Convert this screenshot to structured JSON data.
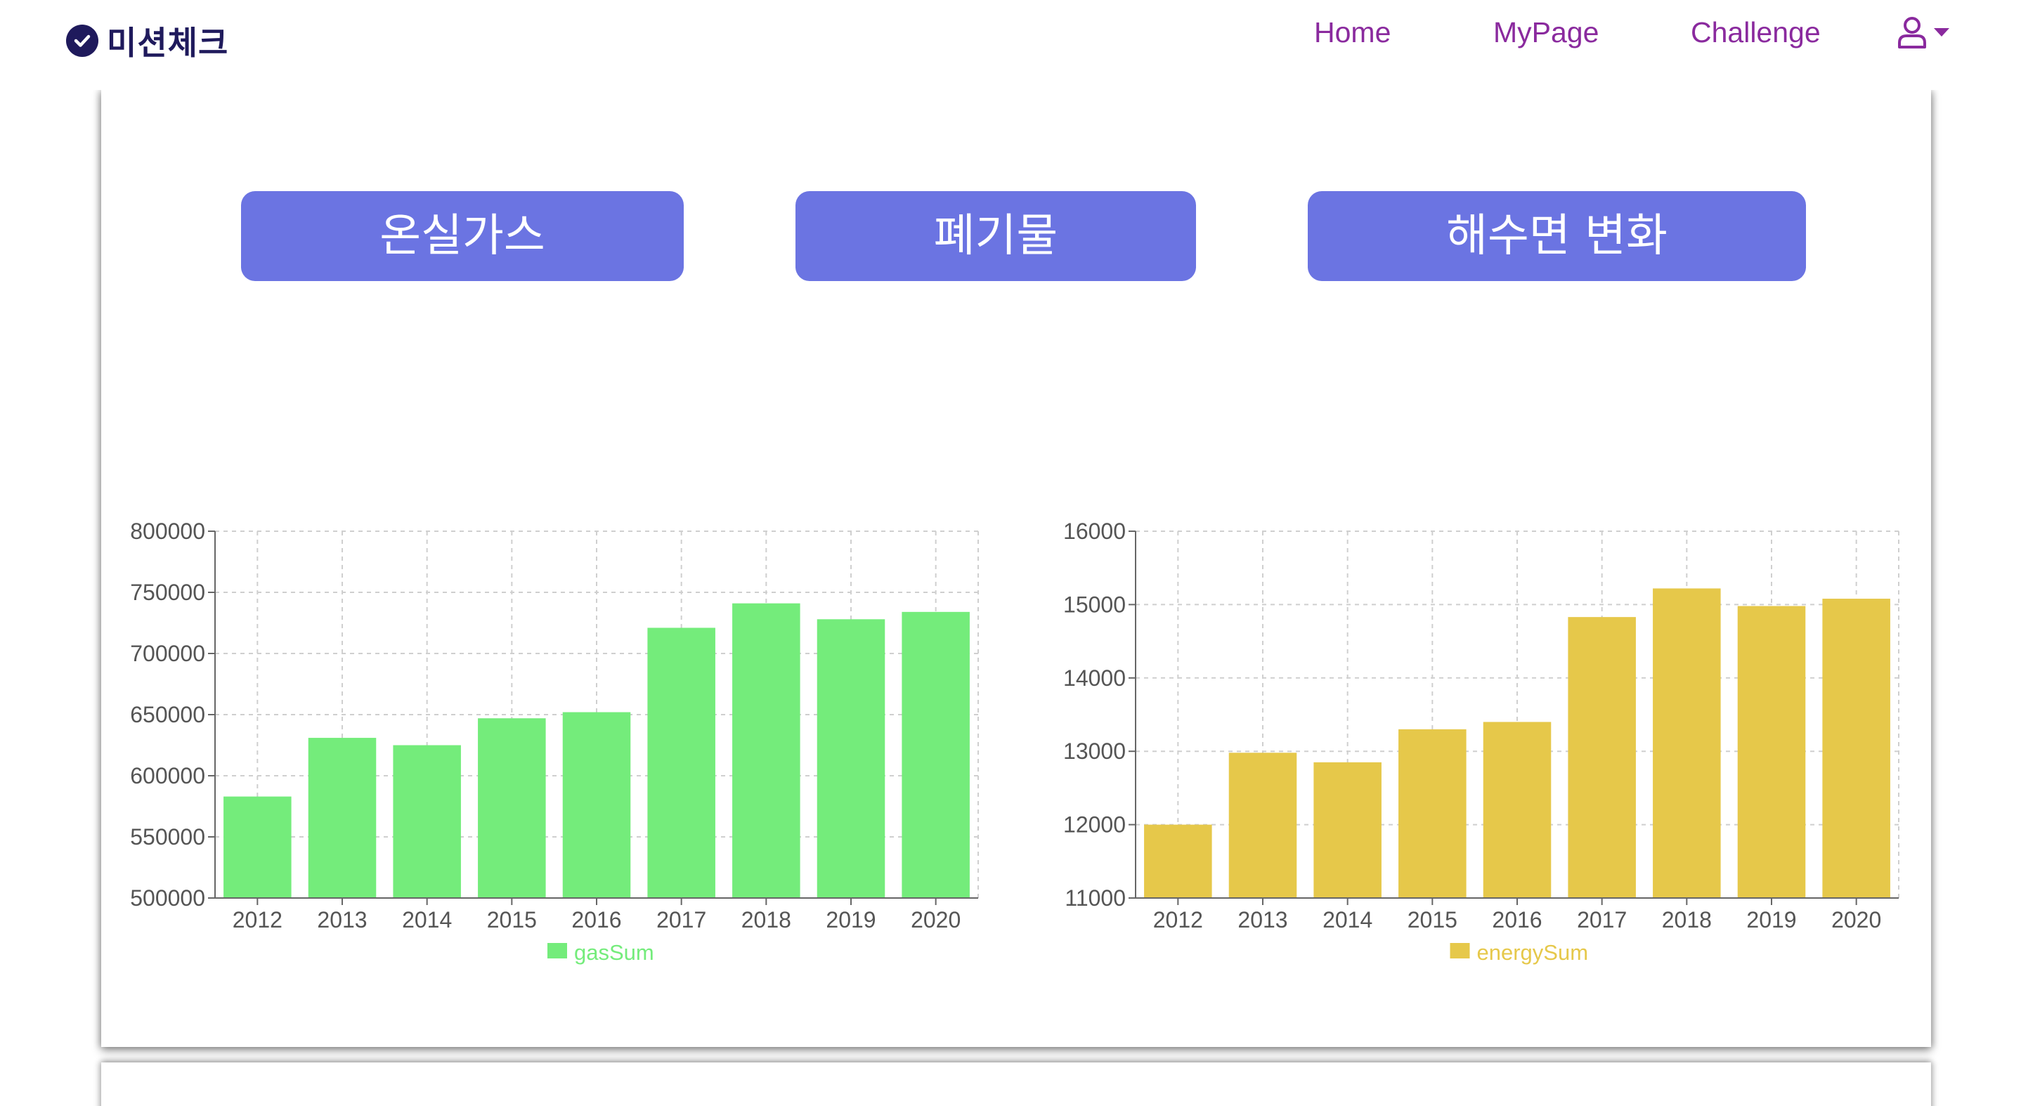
{
  "nav": {
    "brand": "미션체크",
    "links": [
      "Home",
      "MyPage",
      "Challenge"
    ]
  },
  "tabs": [
    "온실가스",
    "폐기물",
    "해수면 변화"
  ],
  "colors": {
    "nav_text": "#8a2a9e",
    "brand": "#1f1a5c",
    "tab_bg": "#6b74e2"
  },
  "chart_data": [
    {
      "type": "bar",
      "categories": [
        "2012",
        "2013",
        "2014",
        "2015",
        "2016",
        "2017",
        "2018",
        "2019",
        "2020"
      ],
      "series": [
        {
          "name": "gasSum",
          "color": "#74ec7b",
          "values": [
            583000,
            631000,
            625000,
            647000,
            652000,
            721000,
            741000,
            728000,
            734000
          ]
        }
      ],
      "ylim": [
        500000,
        800000
      ],
      "yticks": [
        500000,
        550000,
        600000,
        650000,
        700000,
        750000,
        800000
      ],
      "grid": true,
      "legend": "bottom-center"
    },
    {
      "type": "bar",
      "categories": [
        "2012",
        "2013",
        "2014",
        "2015",
        "2016",
        "2017",
        "2018",
        "2019",
        "2020"
      ],
      "series": [
        {
          "name": "energySum",
          "color": "#e6c84a",
          "values": [
            12000,
            12980,
            12850,
            13300,
            13400,
            14830,
            15220,
            14980,
            15080
          ]
        }
      ],
      "ylim": [
        11000,
        16000
      ],
      "yticks": [
        11000,
        12000,
        13000,
        14000,
        15000,
        16000
      ],
      "grid": true,
      "legend": "bottom-center"
    }
  ]
}
